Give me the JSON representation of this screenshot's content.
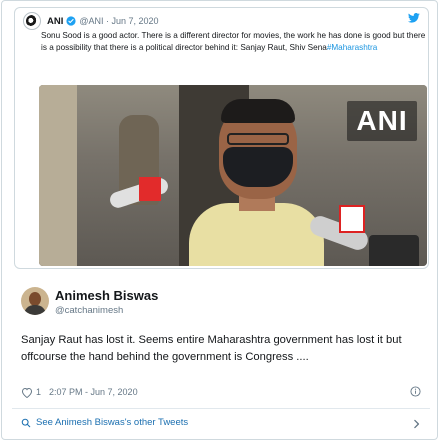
{
  "quoted_tweet": {
    "name": "ANI",
    "meta": "@ANI · Jun 7, 2020",
    "text": "Sonu Sood is a good actor. There is a different director for movies, the work he has done is good but there is a possibility that there is a political director behind it: Sanjay Raut, Shiv Sena",
    "hashtag": "#Maharashtra",
    "media_logo": "ANI"
  },
  "tweet": {
    "name": "Animesh Biswas",
    "handle": "@catchanimesh",
    "text": "Sanjay Raut has lost it. Seems entire Maharashtra government has lost it but offcourse the hand behind the government is Congress ....",
    "likes": "1",
    "timestamp": "2:07 PM - Jun 7, 2020"
  },
  "footer": {
    "see_more": "See Animesh Biswas's other Tweets"
  },
  "colors": {
    "link": "#1b95e0",
    "muted": "#657786",
    "border": "#cfd9de"
  },
  "icons": [
    "verified-icon",
    "twitter-bird-icon",
    "heart-icon",
    "info-icon",
    "search-icon",
    "chevron-right-icon"
  ]
}
